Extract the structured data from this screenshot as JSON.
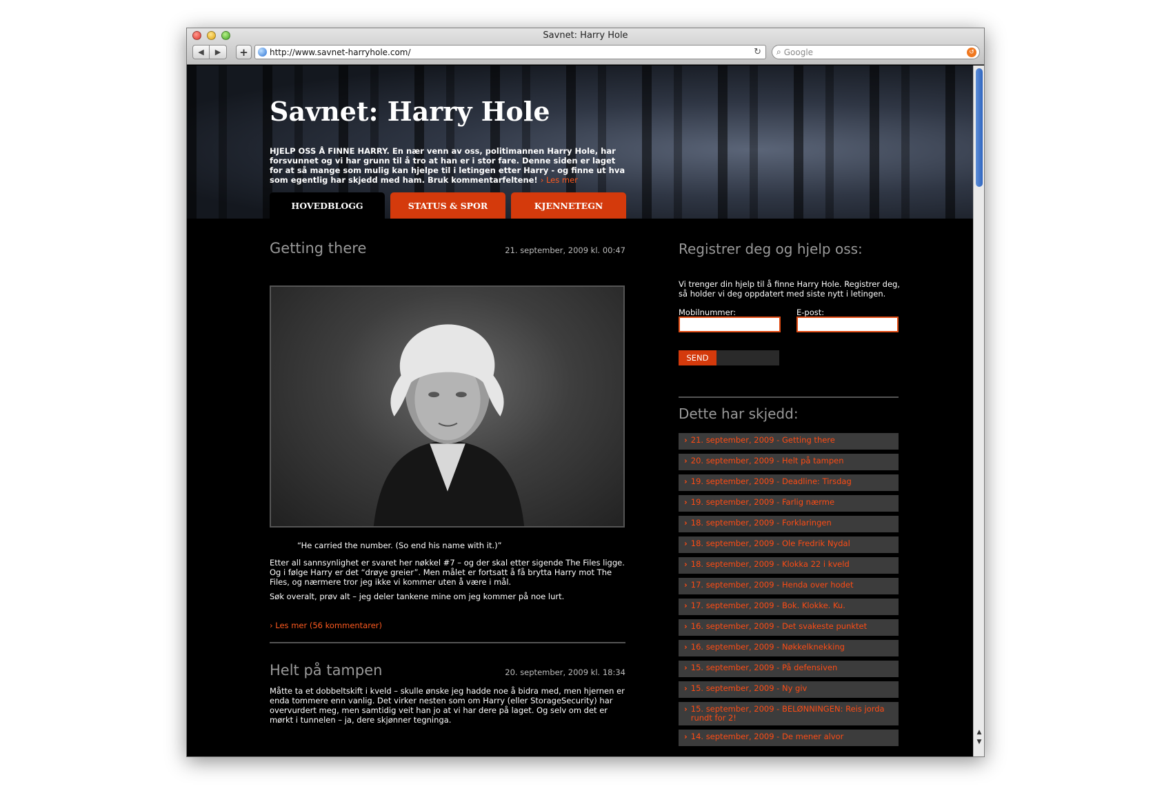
{
  "browser": {
    "title": "Savnet: Harry Hole",
    "url": "http://www.savnet-harryhole.com/",
    "search_placeholder": "Google"
  },
  "header": {
    "site_title": "Savnet: Harry Hole",
    "intro": "HJELP OSS Å FINNE HARRY. En nær venn av oss, politimannen Harry Hole, har forsvunnet og vi har grunn til å tro at han er i stor fare. Denne siden er laget for at så mange som mulig kan hjelpe til i letingen etter Harry - og finne ut hva som egentlig har skjedd med ham. Bruk kommentarfeltene!",
    "intro_more": "Les mer",
    "tabs": [
      "HOVEDBLOGG",
      "STATUS & SPOR",
      "KJENNETEGN"
    ]
  },
  "posts": [
    {
      "title": "Getting there",
      "date": "21. september, 2009 kl. 00:47",
      "quote": "“He carried the number. (So end his name with it.)”",
      "para1": "Etter all sannsynlighet er svaret her nøkkel #7 – og der skal etter sigende The Files ligge. Og i følge Harry er det “drøye greier”. Men målet er fortsatt å få brytta Harry mot The Files, og nærmere tror jeg ikke vi kommer uten å være i mål.",
      "para2": "Søk overalt, prøv alt – jeg deler tankene mine om jeg kommer på noe lurt.",
      "readmore": "Les mer (56 kommentarer)"
    },
    {
      "title": "Helt på tampen",
      "date": "20. september, 2009 kl. 18:34",
      "para1": "Måtte ta et dobbeltskift i kveld – skulle ønske jeg hadde noe å bidra med, men hjernen er enda tommere enn vanlig. Det virker nesten som om Harry (eller StorageSecurity) har overvurdert meg, men samtidig veit han jo at vi har dere på laget. Og selv om det er mørkt i tunnelen – ja, dere skjønner tegninga."
    }
  ],
  "sidebar": {
    "register_title": "Registrer deg og hjelp oss:",
    "register_text": "Vi trenger din hjelp til å finne Harry Hole. Registrer deg, så holder vi deg oppdatert med siste nytt i letingen.",
    "mobile_label": "Mobilnummer:",
    "email_label": "E-post:",
    "send_label": "SEND",
    "events_title": "Dette har skjedd:",
    "events": [
      "21. september, 2009 - Getting there",
      "20. september, 2009 - Helt på tampen",
      "19. september, 2009 - Deadline: Tirsdag",
      "19. september, 2009 - Farlig nærme",
      "18. september, 2009 - Forklaringen",
      "18. september, 2009 - Ole Fredrik Nydal",
      "18. september, 2009 - Klokka 22 i kveld",
      "17. september, 2009 - Henda over hodet",
      "17. september, 2009 - Bok. Klokke. Ku.",
      "16. september, 2009 - Det svakeste punktet",
      "16. september, 2009 - Nøkkelknekking",
      "15. september, 2009 - På defensiven",
      "15. september, 2009 - Ny giv",
      "15. september, 2009 - BELØNNINGEN: Reis jorda rundt for 2!",
      "14. september, 2009 - De mener alvor"
    ]
  },
  "colors": {
    "accent": "#d43a0c",
    "link": "#ff4c14",
    "background": "#000000"
  }
}
